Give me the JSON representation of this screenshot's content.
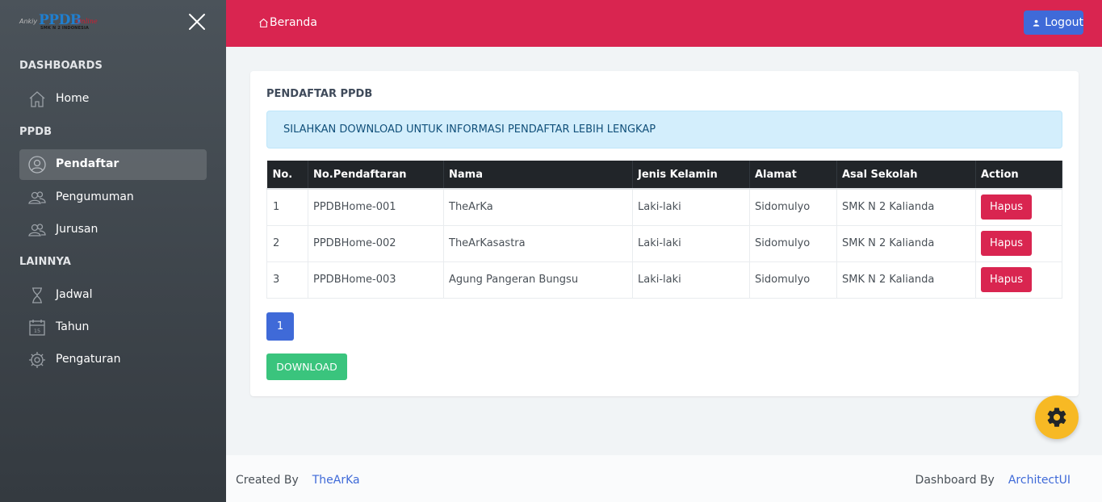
{
  "brand": {
    "logo_main": "PPDB",
    "logo_script": "Online",
    "logo_sub": "SMK N 2 INDONESIA",
    "logo_left": "Ankiy"
  },
  "sidebar": {
    "sections": [
      {
        "heading": "DASHBOARDS",
        "items": [
          {
            "label": "Home",
            "icon": "home-icon"
          }
        ]
      },
      {
        "heading": "PPDB",
        "items": [
          {
            "label": "Pendaftar",
            "icon": "user-circle-icon",
            "active": true
          },
          {
            "label": "Pengumuman",
            "icon": "users-icon"
          },
          {
            "label": "Jurusan",
            "icon": "users-icon"
          }
        ]
      },
      {
        "heading": "LAINNYA",
        "items": [
          {
            "label": "Jadwal",
            "icon": "hourglass-icon"
          },
          {
            "label": "Tahun",
            "icon": "calendar-icon"
          },
          {
            "label": "Pengaturan",
            "icon": "gear-icon"
          }
        ]
      }
    ]
  },
  "header": {
    "breadcrumb": "Beranda",
    "logout_label": "Logout"
  },
  "main": {
    "title": "PENDAFTAR PPDB",
    "alert": "SILAHKAN DOWNLOAD UNTUK INFORMASI PENDAFTAR LEBIH LENGKAP",
    "table": {
      "columns": [
        "No.",
        "No.Pendaftaran",
        "Nama",
        "Jenis Kelamin",
        "Alamat",
        "Asal Sekolah",
        "Action"
      ],
      "rows": [
        [
          "1",
          "PPDBHome-001",
          "TheArKa",
          "Laki-laki",
          "Sidomulyo",
          "SMK N 2 Kalianda",
          "Hapus"
        ],
        [
          "2",
          "PPDBHome-002",
          "TheArKasastra",
          "Laki-laki",
          "Sidomulyo",
          "SMK N 2 Kalianda",
          "Hapus"
        ],
        [
          "3",
          "PPDBHome-003",
          "Agung Pangeran Bungsu",
          "Laki-laki",
          "Sidomulyo",
          "SMK N 2 Kalianda",
          "Hapus"
        ]
      ]
    },
    "pagination_page": "1",
    "download_label": "DOWNLOAD"
  },
  "footer": {
    "created_by_label": "Created By",
    "created_by_link": "TheArKa",
    "dashboard_by_label": "Dashboard By",
    "dashboard_by_link": "ArchitectUI"
  },
  "colors": {
    "header": "#d92550",
    "primary": "#3f6ad8",
    "success": "#3ac47d",
    "danger": "#d92550",
    "warning": "#f7b924"
  }
}
